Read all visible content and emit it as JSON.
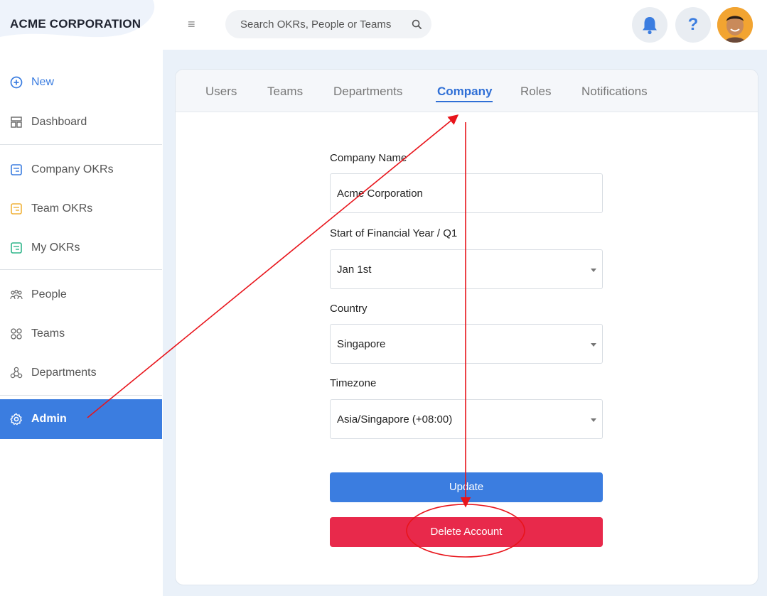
{
  "brand": "ACME CORPORATION",
  "search": {
    "placeholder": "Search OKRs, People or Teams"
  },
  "header": {
    "help_label": "?"
  },
  "sidebar": {
    "items": [
      {
        "label": "New",
        "icon": "plus-circle-icon"
      },
      {
        "label": "Dashboard",
        "icon": "dashboard-icon"
      },
      {
        "label": "Company OKRs",
        "icon": "company-okr-icon"
      },
      {
        "label": "Team OKRs",
        "icon": "team-okr-icon"
      },
      {
        "label": "My OKRs",
        "icon": "my-okr-icon"
      },
      {
        "label": "People",
        "icon": "people-icon"
      },
      {
        "label": "Teams",
        "icon": "teams-icon"
      },
      {
        "label": "Departments",
        "icon": "departments-icon"
      },
      {
        "label": "Admin",
        "icon": "gear-icon"
      }
    ],
    "active": "Admin"
  },
  "tabs": [
    {
      "label": "Users"
    },
    {
      "label": "Teams"
    },
    {
      "label": "Departments"
    },
    {
      "label": "Company"
    },
    {
      "label": "Roles"
    },
    {
      "label": "Notifications"
    }
  ],
  "active_tab": "Company",
  "form": {
    "company_name": {
      "label": "Company Name",
      "value": "Acme Corporation"
    },
    "financial_year": {
      "label": "Start of Financial Year / Q1",
      "value": "Jan 1st"
    },
    "country": {
      "label": "Country",
      "value": "Singapore"
    },
    "timezone": {
      "label": "Timezone",
      "value": "Asia/Singapore (+08:00)"
    },
    "update_label": "Update",
    "delete_label": "Delete Account"
  },
  "colors": {
    "accent": "#3b7de0",
    "danger": "#e8294b",
    "annotation": "#e8141b",
    "main_bg": "#eaf1f9"
  }
}
